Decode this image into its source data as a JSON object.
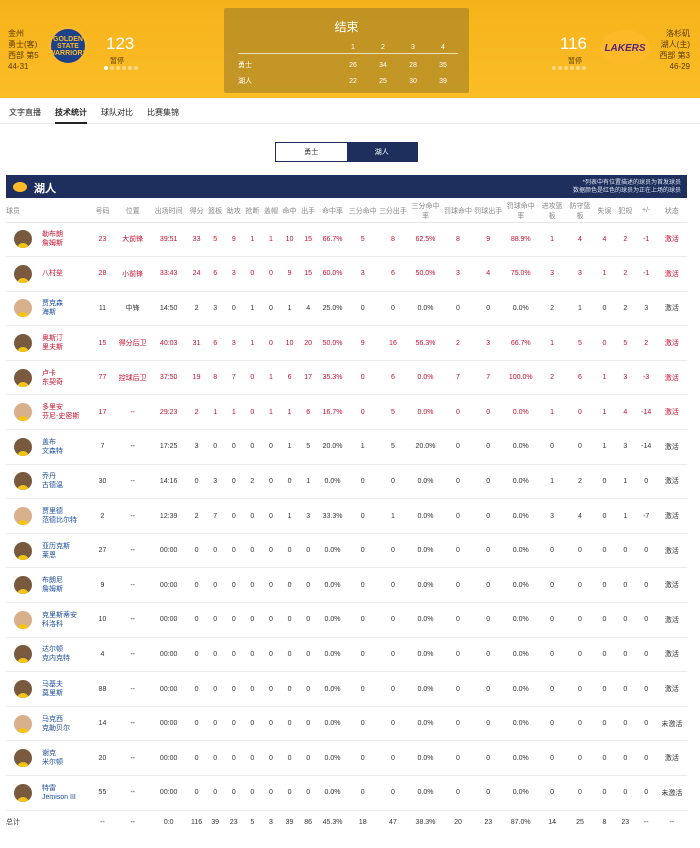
{
  "header": {
    "home": {
      "city": "金州",
      "name": "勇士(客)",
      "rank": "西部 第5",
      "record": "44-31",
      "logo_text": "GOLDEN STATE WARRIORS",
      "score": "123",
      "timeout_label": "暂停"
    },
    "away": {
      "city": "洛杉矶",
      "name": "湖人(主)",
      "rank": "西部 第3",
      "record": "46-29",
      "logo_text": "LAKERS",
      "score": "116",
      "timeout_label": "暂停"
    },
    "status": "结束",
    "quarters": [
      "1",
      "2",
      "3",
      "4"
    ],
    "lines": [
      {
        "team": "勇士",
        "q": [
          "26",
          "34",
          "28",
          "35"
        ]
      },
      {
        "team": "湖人",
        "q": [
          "22",
          "25",
          "30",
          "39"
        ]
      }
    ]
  },
  "tabs": [
    "文字直播",
    "技术统计",
    "球队对比",
    "比赛集锦"
  ],
  "active_tab": "技术统计",
  "segment": {
    "left": "勇士",
    "right": "湖人"
  },
  "team_bar": {
    "name": "湖人",
    "note_line1": "*列表中有位置描述的球员为首发球员",
    "note_line2": "数据颜色是红色的球员为正在上场的球员"
  },
  "columns": [
    "球员",
    "号码",
    "位置",
    "出场时间",
    "得分",
    "篮板",
    "助攻",
    "抢断",
    "盖帽",
    "命中",
    "出手",
    "命中率",
    "三分命中",
    "三分出手",
    "三分命中率",
    "罚球命中",
    "罚球出手",
    "罚球命中率",
    "进攻篮板",
    "防守篮板",
    "失误",
    "犯规",
    "+/-",
    "状态"
  ],
  "players": [
    {
      "name1": "勒布朗",
      "name2": "詹姆斯",
      "starter": true,
      "cells": [
        "23",
        "大前锋",
        "39:51",
        "33",
        "5",
        "9",
        "1",
        "1",
        "10",
        "15",
        "66.7%",
        "5",
        "8",
        "62.5%",
        "8",
        "9",
        "88.9%",
        "1",
        "4",
        "4",
        "2",
        "-1",
        "激活"
      ]
    },
    {
      "name1": "八村垒",
      "name2": "",
      "starter": true,
      "cells": [
        "28",
        "小前锋",
        "33:43",
        "24",
        "6",
        "3",
        "0",
        "0",
        "9",
        "15",
        "60.0%",
        "3",
        "6",
        "50.0%",
        "3",
        "4",
        "75.0%",
        "3",
        "3",
        "1",
        "2",
        "-1",
        "激活"
      ]
    },
    {
      "name1": "贾克森",
      "name2": "海斯",
      "starter": false,
      "cells": [
        "11",
        "中锋",
        "14:50",
        "2",
        "3",
        "0",
        "1",
        "0",
        "1",
        "4",
        "25.0%",
        "0",
        "0",
        "0.0%",
        "0",
        "0",
        "0.0%",
        "2",
        "1",
        "0",
        "2",
        "3",
        "激活"
      ]
    },
    {
      "name1": "奥斯汀",
      "name2": "里夫斯",
      "starter": true,
      "cells": [
        "15",
        "得分后卫",
        "40:03",
        "31",
        "6",
        "3",
        "1",
        "0",
        "10",
        "20",
        "50.0%",
        "9",
        "16",
        "56.3%",
        "2",
        "3",
        "66.7%",
        "1",
        "5",
        "0",
        "5",
        "2",
        "激活"
      ]
    },
    {
      "name1": "卢卡",
      "name2": "东契奇",
      "starter": true,
      "cells": [
        "77",
        "控球后卫",
        "37:50",
        "19",
        "8",
        "7",
        "0",
        "1",
        "6",
        "17",
        "35.3%",
        "0",
        "6",
        "0.0%",
        "7",
        "7",
        "100.0%",
        "2",
        "6",
        "1",
        "3",
        "-3",
        "激活"
      ]
    },
    {
      "name1": "多里安",
      "name2": "芬尼-史密斯",
      "starter": true,
      "cells": [
        "17",
        "--",
        "29:23",
        "2",
        "1",
        "1",
        "0",
        "1",
        "1",
        "6",
        "16.7%",
        "0",
        "5",
        "0.0%",
        "0",
        "0",
        "0.0%",
        "1",
        "0",
        "1",
        "4",
        "-14",
        "激活"
      ]
    },
    {
      "name1": "盖布",
      "name2": "文森特",
      "starter": false,
      "cells": [
        "7",
        "--",
        "17:25",
        "3",
        "0",
        "0",
        "0",
        "0",
        "1",
        "5",
        "20.0%",
        "1",
        "5",
        "20.0%",
        "0",
        "0",
        "0.0%",
        "0",
        "0",
        "1",
        "3",
        "-14",
        "激活"
      ]
    },
    {
      "name1": "乔丹",
      "name2": "古德温",
      "starter": false,
      "cells": [
        "30",
        "--",
        "14:16",
        "0",
        "3",
        "0",
        "2",
        "0",
        "0",
        "1",
        "0.0%",
        "0",
        "0",
        "0.0%",
        "0",
        "0",
        "0.0%",
        "1",
        "2",
        "0",
        "1",
        "0",
        "激活"
      ]
    },
    {
      "name1": "贾里德",
      "name2": "范德比尔特",
      "starter": false,
      "cells": [
        "2",
        "--",
        "12:39",
        "2",
        "7",
        "0",
        "0",
        "0",
        "1",
        "3",
        "33.3%",
        "0",
        "1",
        "0.0%",
        "0",
        "0",
        "0.0%",
        "3",
        "4",
        "0",
        "1",
        "-7",
        "激活"
      ]
    },
    {
      "name1": "亚历克斯",
      "name2": "莱恩",
      "starter": false,
      "cells": [
        "27",
        "--",
        "00:00",
        "0",
        "0",
        "0",
        "0",
        "0",
        "0",
        "0",
        "0.0%",
        "0",
        "0",
        "0.0%",
        "0",
        "0",
        "0.0%",
        "0",
        "0",
        "0",
        "0",
        "0",
        "激活"
      ]
    },
    {
      "name1": "布朗尼",
      "name2": "詹姆斯",
      "starter": false,
      "cells": [
        "9",
        "--",
        "00:00",
        "0",
        "0",
        "0",
        "0",
        "0",
        "0",
        "0",
        "0.0%",
        "0",
        "0",
        "0.0%",
        "0",
        "0",
        "0.0%",
        "0",
        "0",
        "0",
        "0",
        "0",
        "激活"
      ]
    },
    {
      "name1": "克里斯蒂安",
      "name2": "科洛科",
      "starter": false,
      "cells": [
        "10",
        "--",
        "00:00",
        "0",
        "0",
        "0",
        "0",
        "0",
        "0",
        "0",
        "0.0%",
        "0",
        "0",
        "0.0%",
        "0",
        "0",
        "0.0%",
        "0",
        "0",
        "0",
        "0",
        "0",
        "激活"
      ]
    },
    {
      "name1": "达尔顿",
      "name2": "克内克特",
      "starter": false,
      "cells": [
        "4",
        "--",
        "00:00",
        "0",
        "0",
        "0",
        "0",
        "0",
        "0",
        "0",
        "0.0%",
        "0",
        "0",
        "0.0%",
        "0",
        "0",
        "0.0%",
        "0",
        "0",
        "0",
        "0",
        "0",
        "激活"
      ]
    },
    {
      "name1": "马基夫",
      "name2": "莫里斯",
      "starter": false,
      "cells": [
        "88",
        "--",
        "00:00",
        "0",
        "0",
        "0",
        "0",
        "0",
        "0",
        "0",
        "0.0%",
        "0",
        "0",
        "0.0%",
        "0",
        "0",
        "0.0%",
        "0",
        "0",
        "0",
        "0",
        "0",
        "激活"
      ]
    },
    {
      "name1": "马克西",
      "name2": "克勒贝尔",
      "starter": false,
      "cells": [
        "14",
        "--",
        "00:00",
        "0",
        "0",
        "0",
        "0",
        "0",
        "0",
        "0",
        "0.0%",
        "0",
        "0",
        "0.0%",
        "0",
        "0",
        "0.0%",
        "0",
        "0",
        "0",
        "0",
        "0",
        "未激活"
      ]
    },
    {
      "name1": "谢克",
      "name2": "米尔顿",
      "starter": false,
      "cells": [
        "20",
        "--",
        "00:00",
        "0",
        "0",
        "0",
        "0",
        "0",
        "0",
        "0",
        "0.0%",
        "0",
        "0",
        "0.0%",
        "0",
        "0",
        "0.0%",
        "0",
        "0",
        "0",
        "0",
        "0",
        "激活"
      ]
    },
    {
      "name1": "特雷",
      "name2": "Jemison III",
      "starter": false,
      "cells": [
        "55",
        "--",
        "00:00",
        "0",
        "0",
        "0",
        "0",
        "0",
        "0",
        "0",
        "0.0%",
        "0",
        "0",
        "0.0%",
        "0",
        "0",
        "0.0%",
        "0",
        "0",
        "0",
        "0",
        "0",
        "未激活"
      ]
    }
  ],
  "totals": {
    "label": "总计",
    "cells": [
      "--",
      "--",
      "0:0",
      "116",
      "39",
      "23",
      "5",
      "3",
      "39",
      "86",
      "45.3%",
      "18",
      "47",
      "38.3%",
      "20",
      "23",
      "87.0%",
      "14",
      "25",
      "8",
      "23",
      "--",
      "--"
    ]
  },
  "colors": {
    "header_gold": "#f9b31a",
    "navy": "#1e2f5e",
    "starter_red": "#c8102e",
    "bench_blue": "#1a4e9c"
  }
}
